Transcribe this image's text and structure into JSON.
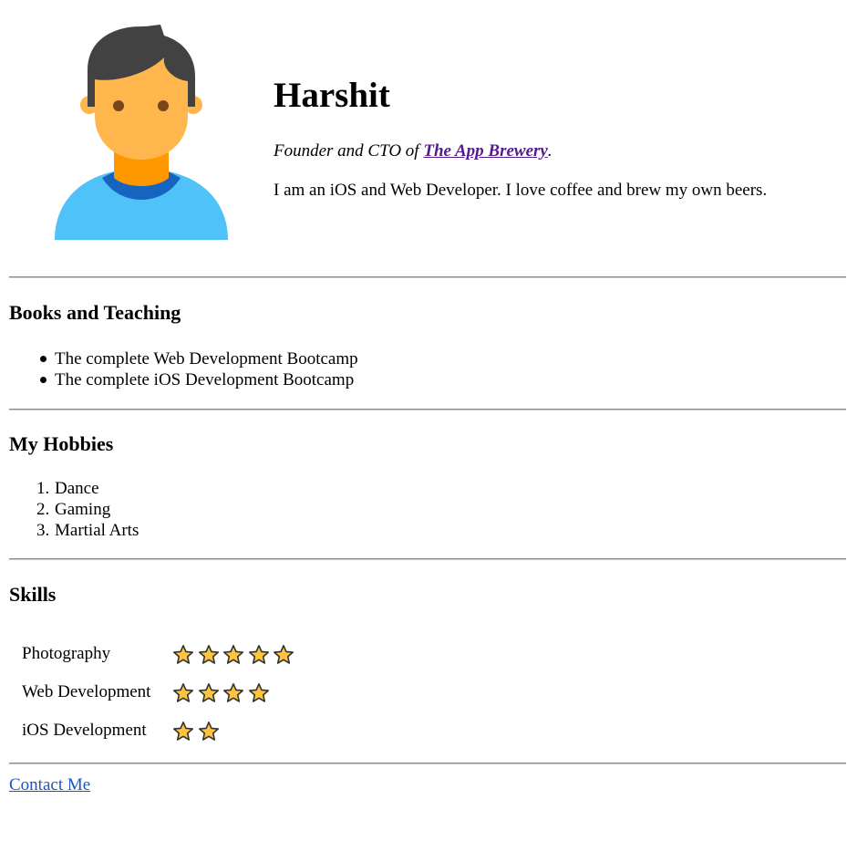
{
  "profile": {
    "name": "Harshit",
    "tagline_prefix": "Founder and CTO of ",
    "company_link": "The App Brewery",
    "tagline_suffix": ".",
    "bio": "I am an iOS and Web Developer. I love coffee and brew my own beers."
  },
  "books": {
    "title": "Books and Teaching",
    "items": [
      "The complete Web Development Bootcamp",
      "The complete iOS Development Bootcamp"
    ]
  },
  "hobbies": {
    "title": "My Hobbies",
    "items": [
      "Dance",
      "Gaming",
      "Martial Arts"
    ],
    "numbers": [
      "1.",
      "2.",
      "3."
    ]
  },
  "skills": {
    "title": "Skills",
    "rows": [
      {
        "label": "Photography",
        "rating": 5
      },
      {
        "label": "Web Development",
        "rating": 4
      },
      {
        "label": "iOS Development",
        "rating": 2
      }
    ]
  },
  "footer": {
    "contact_label": "Contact Me"
  },
  "colors": {
    "visited_link": "#551a8b",
    "link": "#1a55c8",
    "star_fill": "#ffc43d",
    "star_stroke": "#333333"
  },
  "icons": {
    "avatar": "person-avatar-icon",
    "star": "star-icon"
  }
}
